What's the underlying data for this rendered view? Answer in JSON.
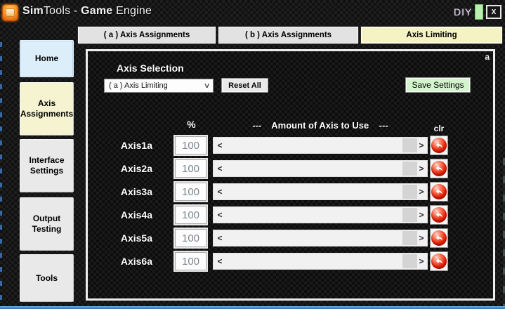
{
  "titlebar": {
    "app_name_bold": "Sim",
    "app_name_rest": "Tools - ",
    "engine_bold": "Game",
    "engine_rest": "Engine",
    "diy_label": "DIY",
    "close_glyph": "X"
  },
  "tabs": [
    {
      "label": "( a ) Axis Assignments",
      "active": false
    },
    {
      "label": "( b ) Axis Assignments",
      "active": false
    },
    {
      "label": "Axis Limiting",
      "active": true
    }
  ],
  "sidebar": {
    "items": [
      {
        "label": "Home"
      },
      {
        "label": "Axis Assignments"
      },
      {
        "label": "Interface Settings"
      },
      {
        "label": "Output Testing"
      },
      {
        "label": "Tools"
      }
    ]
  },
  "panel": {
    "corner_label": "a",
    "axis_selection_label": "Axis Selection",
    "dropdown_value": "( a ) Axis Limiting",
    "reset_all_label": "Reset All",
    "save_settings_label": "Save Settings",
    "table": {
      "percent_header": "%",
      "amount_header": "---    Amount of Axis to Use    ---",
      "clr_header": "clr",
      "rows": [
        {
          "label": "Axis1a",
          "value": "100"
        },
        {
          "label": "Axis2a",
          "value": "100"
        },
        {
          "label": "Axis3a",
          "value": "100"
        },
        {
          "label": "Axis4a",
          "value": "100"
        },
        {
          "label": "Axis5a",
          "value": "100"
        },
        {
          "label": "Axis6a",
          "value": "100"
        }
      ]
    }
  },
  "glyphs": {
    "dropdown_chevron": "∨",
    "scroll_left": "<",
    "scroll_right": ">"
  },
  "colors": {
    "active_tab_yellow": "#f5f2c3",
    "save_button_green": "#d4f4ce",
    "clr_button_red": "#eb2607",
    "home_button_blue": "#ddeefb",
    "axis_button_yellow": "#f6f3d0",
    "led_green": "#b6f0ac",
    "bottom_edge_blue": "#2e72b4",
    "panel_border_white": "#ededed"
  }
}
